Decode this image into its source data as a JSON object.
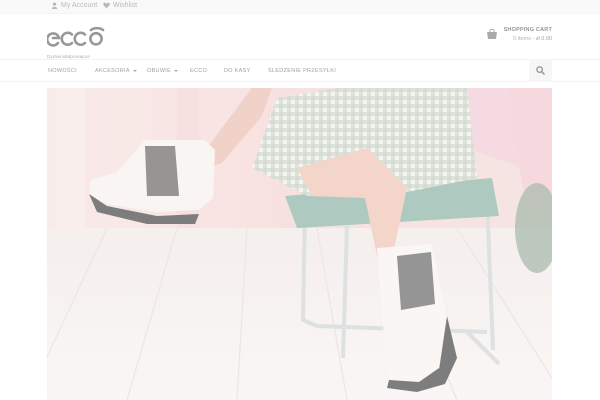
{
  "topbar": {
    "account_label": "My Account",
    "wishlist_label": "Wishlist"
  },
  "header": {
    "logo_text": "ecco",
    "logo_subtitle": "Dymienidulpronapce"
  },
  "cart": {
    "title": "SHOPPING CART",
    "items": "0 items",
    "price": "zł 0.00"
  },
  "nav": {
    "items": [
      {
        "label": "NOWOŚCI"
      },
      {
        "label": "AKCESORIA"
      },
      {
        "label": "OBUWIE"
      },
      {
        "label": "ECCO"
      },
      {
        "label": "DO KASY"
      },
      {
        "label": "ŚLEDZENIE PRZESYŁKI"
      }
    ]
  },
  "colors": {
    "accent": "#7a7a7a",
    "hero_wall": "#f3d3d3",
    "chair_seat": "#7ea99a"
  },
  "icons": {
    "account": "user-icon",
    "wishlist": "heart-icon",
    "cart": "bag-icon",
    "search": "search-icon"
  }
}
